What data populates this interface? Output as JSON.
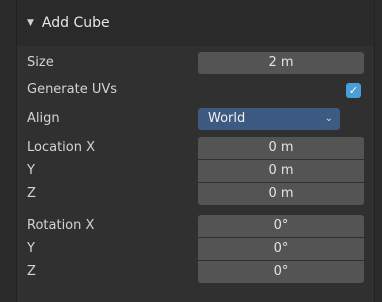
{
  "panel": {
    "title": "Add Cube",
    "caret": "▼"
  },
  "size": {
    "label": "Size",
    "value": "2 m"
  },
  "generate_uvs": {
    "label": "Generate UVs",
    "checked": true,
    "check_glyph": "✓"
  },
  "align": {
    "label": "Align",
    "value": "World",
    "chevron": "⌄"
  },
  "location": {
    "x": {
      "label": "Location X",
      "value": "0 m"
    },
    "y": {
      "label": "Y",
      "value": "0 m"
    },
    "z": {
      "label": "Z",
      "value": "0 m"
    }
  },
  "rotation": {
    "x": {
      "label": "Rotation X",
      "value": "0°"
    },
    "y": {
      "label": "Y",
      "value": "0°"
    },
    "z": {
      "label": "Z",
      "value": "0°"
    }
  },
  "colors": {
    "panel_bg": "#303030",
    "field_bg": "#545454",
    "dropdown_bg": "#3d5a82",
    "checkbox": "#4a9fd8"
  }
}
